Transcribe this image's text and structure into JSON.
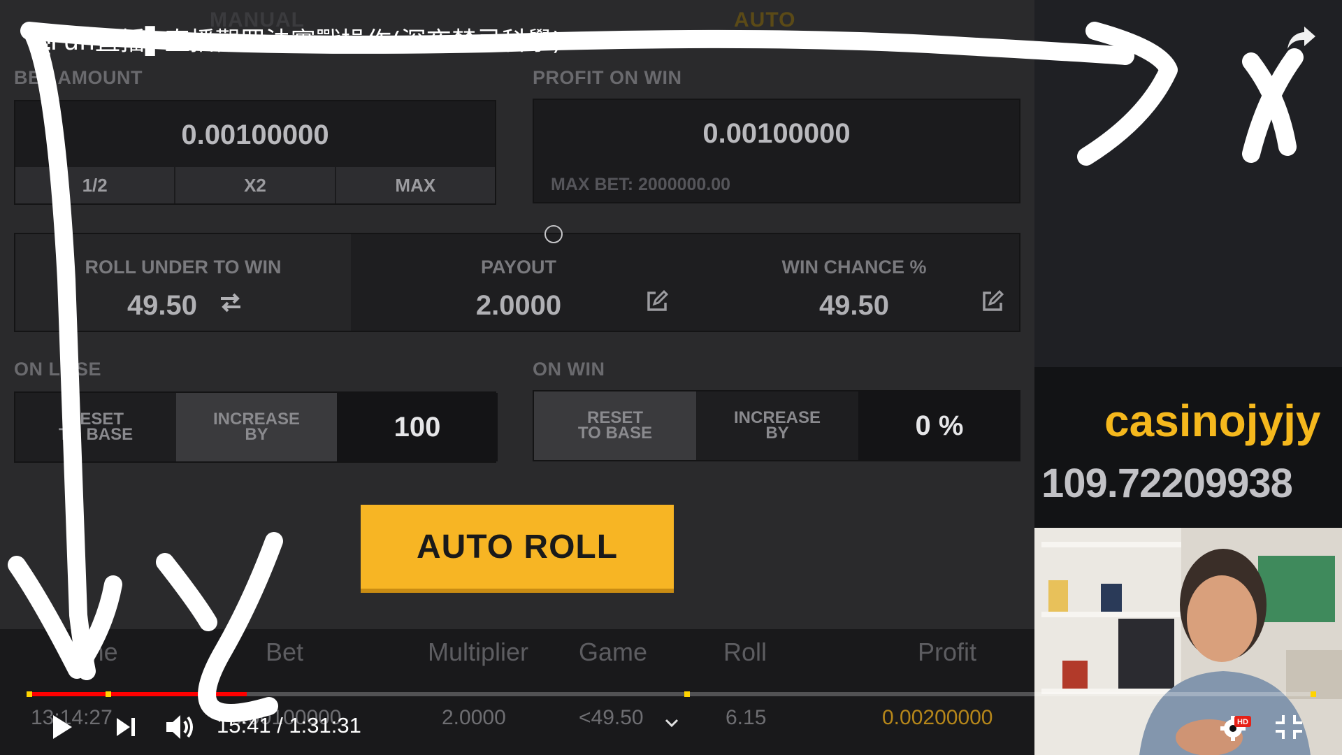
{
  "video": {
    "title": "▒Fun直播▌直播觀眾法實戰操作(深夜禁忌科學)",
    "current_time": "15:41",
    "separator": " / ",
    "duration": "1:31:31",
    "progress_fraction": 0.171,
    "chapter_marks_fraction": [
      0.0,
      0.061,
      0.51,
      0.996
    ],
    "hd_badge": "HD"
  },
  "game": {
    "tabs": {
      "manual": "MANUAL",
      "auto": "AUTO"
    },
    "bet_amount": {
      "label": "BET AMOUNT",
      "value": "0.00100000",
      "half": "1/2",
      "double": "X2",
      "max": "MAX"
    },
    "profit_on_win": {
      "label": "PROFIT ON WIN",
      "value": "0.00100000",
      "max_bet": "MAX BET: 2000000.00"
    },
    "roll_under": {
      "label": "ROLL UNDER TO WIN",
      "value": "49.50"
    },
    "payout": {
      "label": "PAYOUT",
      "value": "2.0000"
    },
    "win_chance": {
      "label": "WIN CHANCE %",
      "value": "49.50"
    },
    "on_lose": {
      "label": "ON LOSE",
      "reset_line1": "RESET",
      "reset_line2": "TO BASE",
      "increase_line1": "INCREASE",
      "increase_line2": "BY",
      "value": "100"
    },
    "on_win": {
      "label": "ON WIN",
      "reset_line1": "RESET",
      "reset_line2": "TO BASE",
      "increase_line1": "INCREASE",
      "increase_line2": "BY",
      "value": "0 %"
    },
    "auto_roll": "AUTO ROLL",
    "table": {
      "headers": [
        "Time",
        "Bet",
        "Multiplier",
        "Game",
        "Roll",
        "Profit"
      ],
      "row": {
        "time": "13:14:27",
        "bet": "0.00100000",
        "multiplier": "2.0000",
        "game": "<49.50",
        "roll": "6.15",
        "profit": "0.00200000"
      }
    }
  },
  "sidebar": {
    "username": "casinojyjy",
    "balance": "109.72209938"
  },
  "drawing": {
    "axis_x_label": "X",
    "axis_y_label": "y"
  },
  "colors": {
    "accent_yellow": "#f7b524",
    "progress_red": "#ff0000",
    "username_gold": "#f5b81d"
  }
}
